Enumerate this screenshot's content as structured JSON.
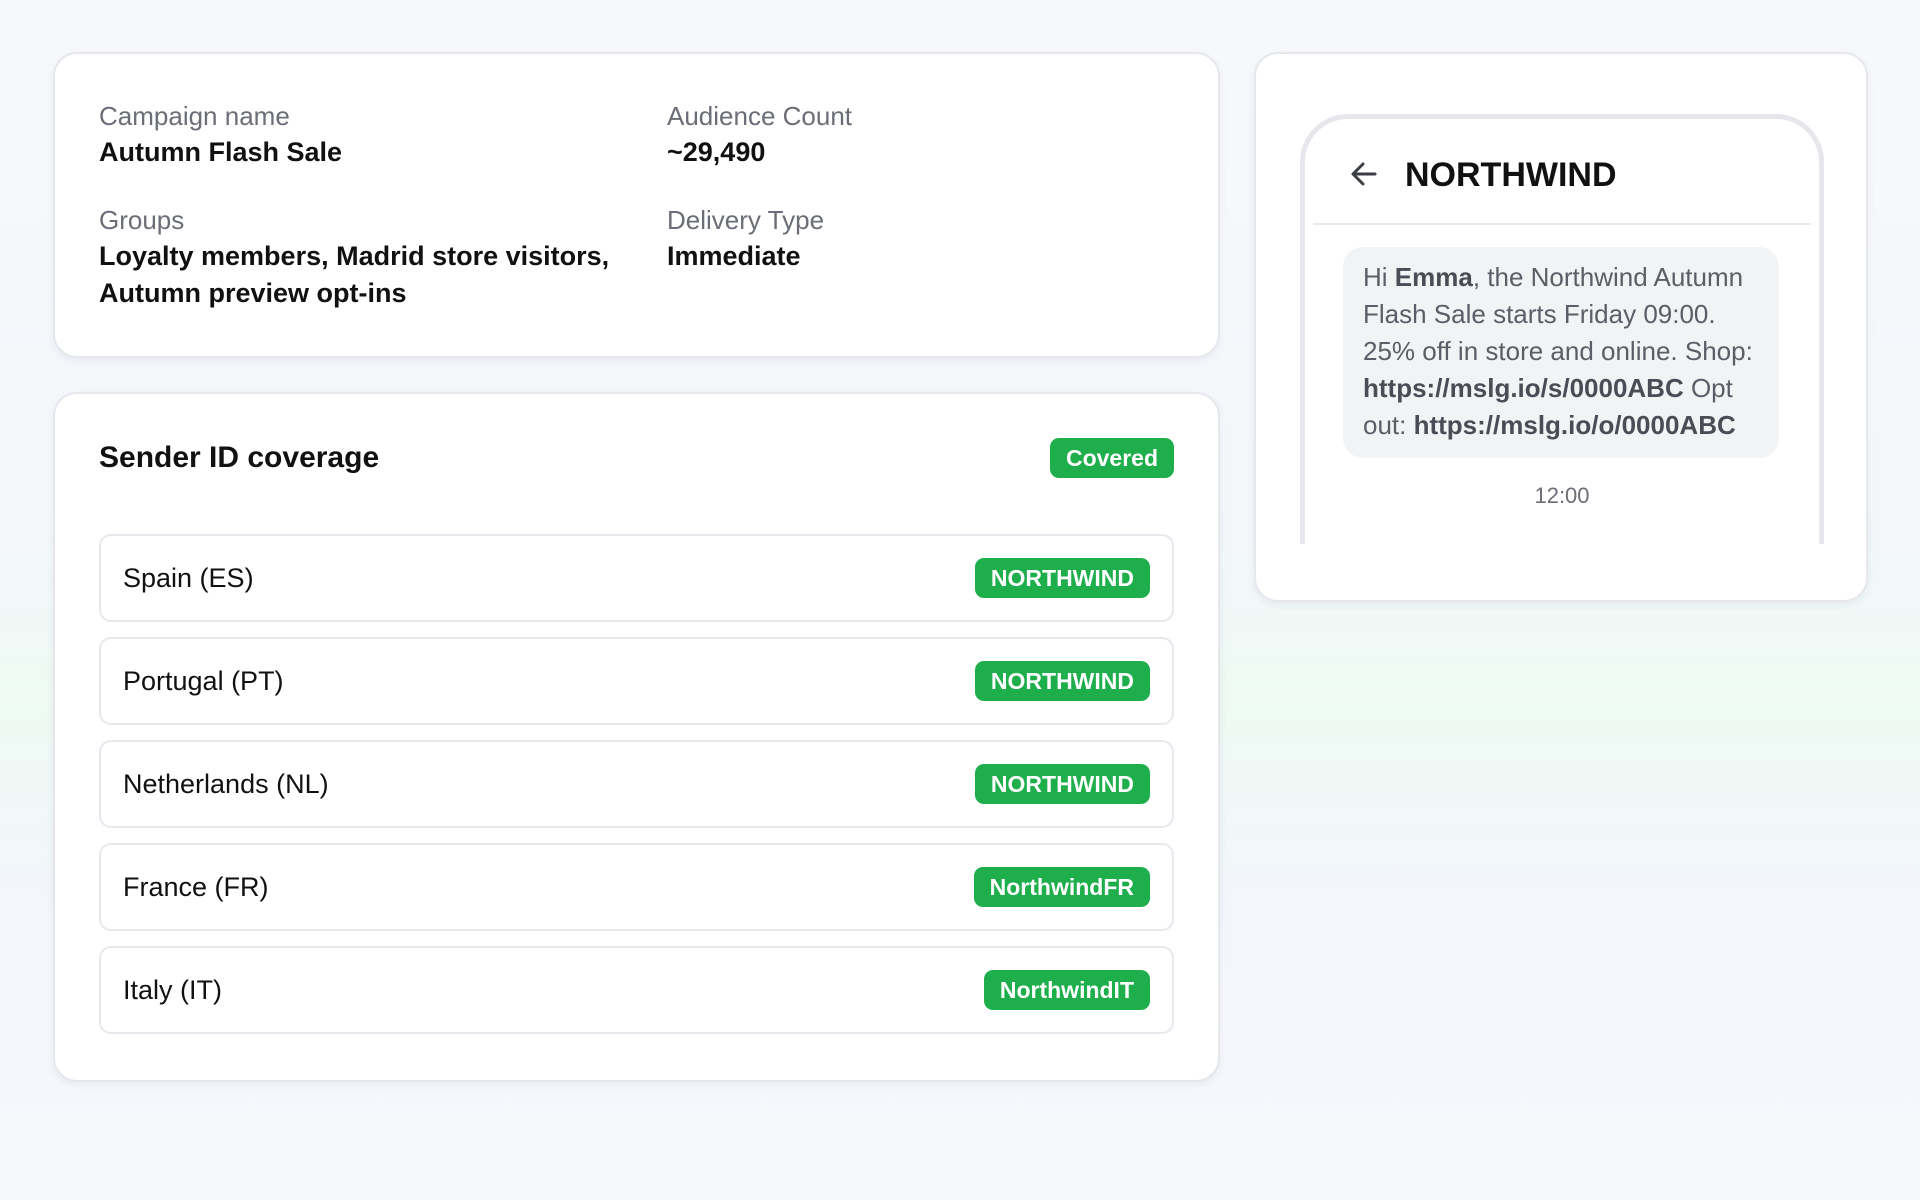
{
  "summary": {
    "campaign_name_label": "Campaign name",
    "campaign_name_value": "Autumn Flash Sale",
    "groups_label": "Groups",
    "groups_value": "Loyalty members, Madrid store visitors, Autumn preview opt-ins",
    "audience_label": "Audience Count",
    "audience_value": "~29,490",
    "delivery_label": "Delivery Type",
    "delivery_value": "Immediate"
  },
  "coverage": {
    "title": "Sender ID coverage",
    "status_badge": "Covered",
    "rows": [
      {
        "country": "Spain (ES)",
        "sender_id": "NORTHWIND"
      },
      {
        "country": "Portugal (PT)",
        "sender_id": "NORTHWIND"
      },
      {
        "country": "Netherlands (NL)",
        "sender_id": "NORTHWIND"
      },
      {
        "country": "France (FR)",
        "sender_id": "NorthwindFR"
      },
      {
        "country": "Italy (IT)",
        "sender_id": "NorthwindIT"
      }
    ]
  },
  "preview": {
    "back_icon": "arrow-left-icon",
    "sender_name": "NORTHWIND",
    "message": {
      "greeting": "Hi ",
      "recipient_name": "Emma",
      "body_1": ", the Northwind Autumn Flash Sale starts Friday 09:00. 25% off in store and online. Shop: ",
      "shop_link": "https://mslg.io/s/0000ABC",
      "body_2": " Opt out: ",
      "optout_link": "https://mslg.io/o/0000ABC"
    },
    "time": "12:00"
  },
  "colors": {
    "badge_green": "#1fae4c",
    "card_border": "#e6e8ee",
    "label_gray": "#6b6e76"
  }
}
